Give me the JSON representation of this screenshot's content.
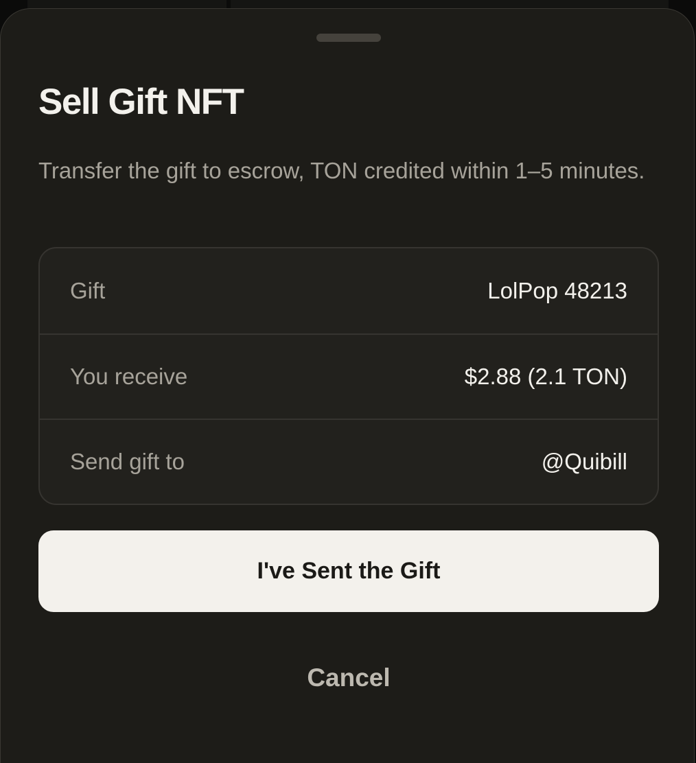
{
  "sheet": {
    "title": "Sell Gift NFT",
    "description": "Transfer the gift to escrow, TON credited within 1–5 minutes."
  },
  "details": [
    {
      "label": "Gift",
      "value": "LolPop 48213"
    },
    {
      "label": "You receive",
      "value": "$2.88 (2.1 TON)"
    },
    {
      "label": "Send gift to",
      "value": "@Quibill"
    }
  ],
  "actions": {
    "confirm_label": "I've Sent the Gift",
    "cancel_label": "Cancel"
  },
  "colors": {
    "sheet_background": "#1d1c18",
    "primary_button": "#f3f1ec",
    "text_primary": "#f3f1ec",
    "text_secondary": "#a7a39a"
  }
}
